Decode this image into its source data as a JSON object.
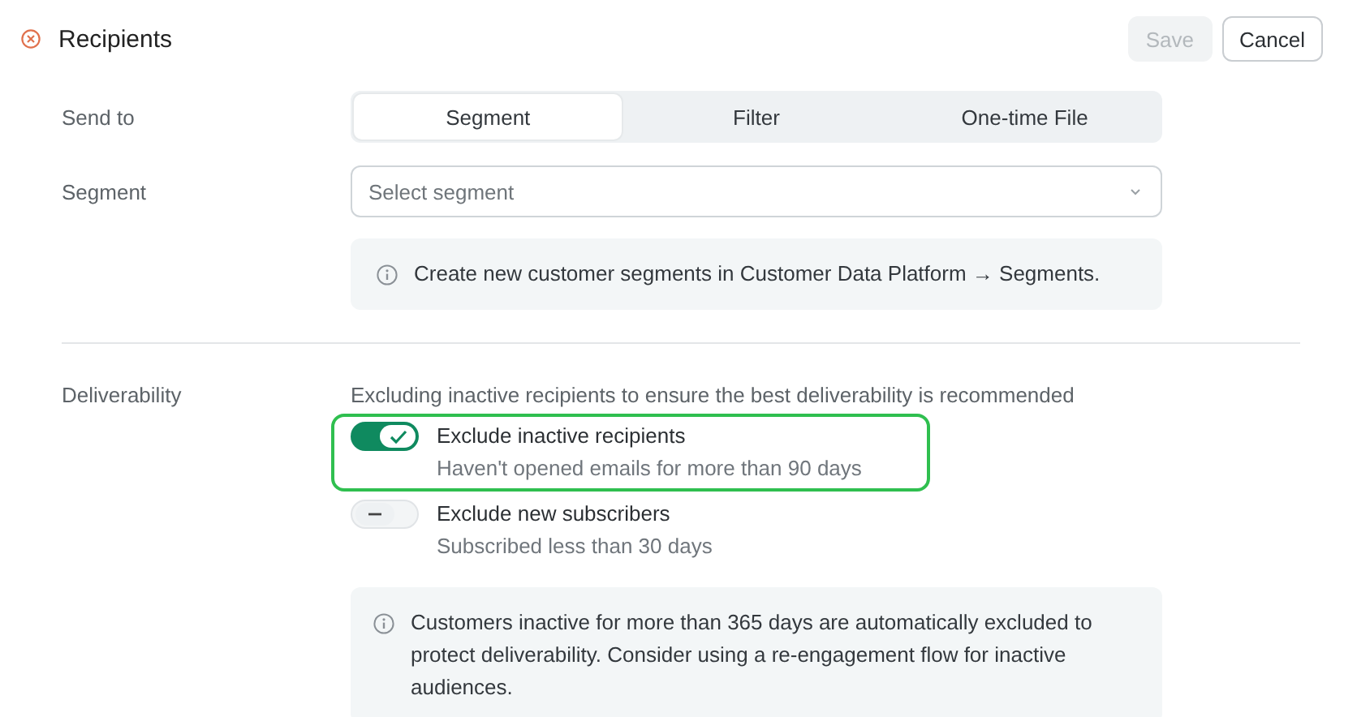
{
  "header": {
    "title": "Recipients",
    "buttons": [
      {
        "label": "Save",
        "disabled": true
      },
      {
        "label": "Cancel",
        "disabled": false
      }
    ]
  },
  "send_to": {
    "label": "Send to",
    "tabs": [
      {
        "label": "Segment",
        "selected": true
      },
      {
        "label": "Filter",
        "selected": false
      },
      {
        "label": "One-time File",
        "selected": false
      }
    ]
  },
  "segment": {
    "label": "Segment",
    "placeholder": "Select segment",
    "info": "Create new customer segments in Customer Data Platform → Segments."
  },
  "deliverability": {
    "label": "Deliverability",
    "description": "Excluding inactive recipients to ensure the best deliverability is recommended",
    "options": [
      {
        "title": "Exclude inactive recipients",
        "subtitle": "Haven't opened emails for more than 90 days",
        "on": true,
        "focused": true
      },
      {
        "title": "Exclude new subscribers",
        "subtitle": "Subscribed less than 30 days",
        "on": false,
        "focused": false
      }
    ],
    "info": "Customers inactive for more than 365 days are automatically excluded to protect deliverability. Consider using a re-engagement flow for inactive audiences."
  }
}
